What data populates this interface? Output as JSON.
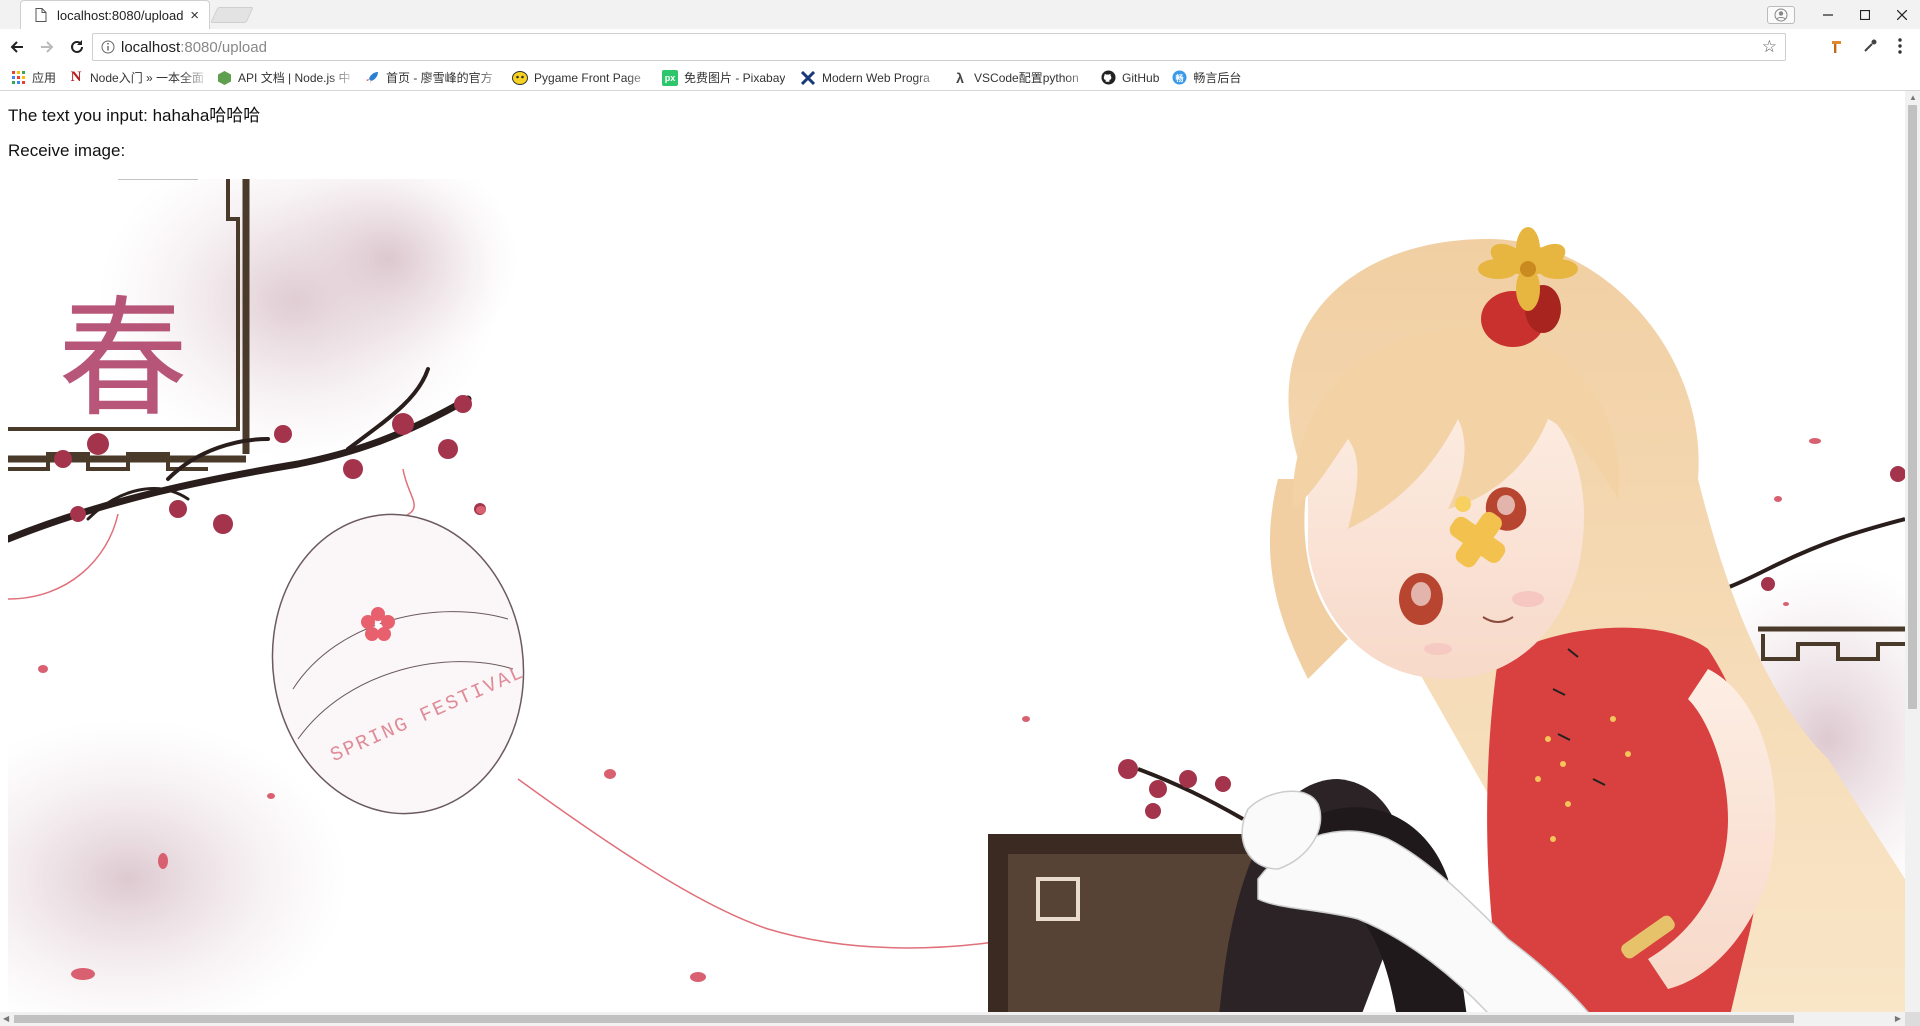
{
  "tab": {
    "title": "localhost:8080/upload",
    "close": "×"
  },
  "address": {
    "host": "localhost",
    "path": ":8080/upload"
  },
  "bookmarks": [
    {
      "label": "应用",
      "icon": "apps-grid-icon"
    },
    {
      "label": "Node入门 » 一本全面",
      "icon": "node-n-icon"
    },
    {
      "label": "API 文档 | Node.js 中",
      "icon": "nodejs-hex-icon"
    },
    {
      "label": "首页 - 廖雪峰的官方",
      "icon": "rocket-icon"
    },
    {
      "label": "Pygame Front Page",
      "icon": "pygame-icon"
    },
    {
      "label": "免费图片 - Pixabay",
      "icon": "pixabay-icon"
    },
    {
      "label": "Modern Web Progra",
      "icon": "x-logo-icon"
    },
    {
      "label": "VSCode配置python",
      "icon": "lambda-icon"
    },
    {
      "label": "GitHub",
      "icon": "github-icon"
    },
    {
      "label": "畅言后台",
      "icon": "changyan-icon"
    }
  ],
  "page": {
    "input_line": "The text you input: hahaha哈哈哈",
    "image_label": "Receive image:"
  },
  "image": {
    "calligraphy": "春",
    "egg_text": "SPRING FESTIVAL"
  },
  "colors": {
    "accent_red": "#b03a5b",
    "dress_red": "#d8413f",
    "hair": "#f3d2a6"
  }
}
